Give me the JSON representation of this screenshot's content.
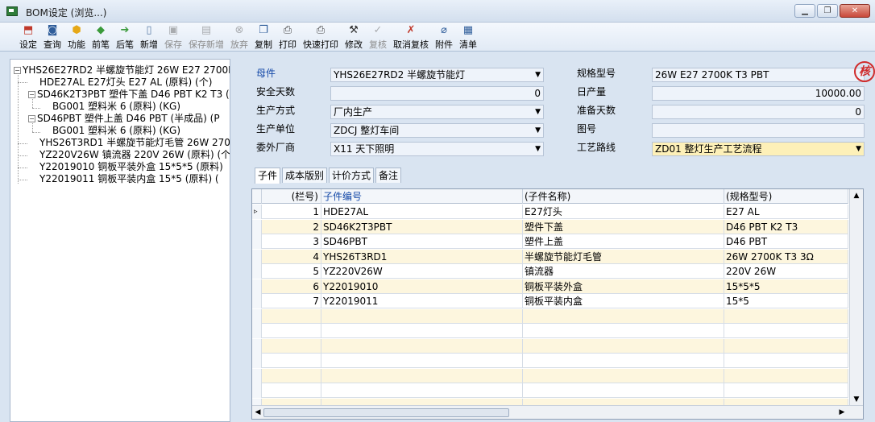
{
  "window": {
    "title": "BOM设定 (浏览...)",
    "controls": [
      "minimize",
      "maximize",
      "close"
    ]
  },
  "toolbar": [
    {
      "label": "设定",
      "icon": "settings-icon",
      "enabled": true
    },
    {
      "label": "查询",
      "icon": "query-icon",
      "enabled": true
    },
    {
      "label": "功能",
      "icon": "function-icon",
      "enabled": true
    },
    {
      "label": "前笔",
      "icon": "prev-icon",
      "enabled": true
    },
    {
      "label": "后笔",
      "icon": "next-icon",
      "enabled": true
    },
    {
      "label": "新增",
      "icon": "new-icon",
      "enabled": true
    },
    {
      "label": "保存",
      "icon": "save-icon",
      "enabled": false
    },
    {
      "label": "保存新增",
      "icon": "save-new-icon",
      "enabled": false
    },
    {
      "label": "放弃",
      "icon": "discard-icon",
      "enabled": false
    },
    {
      "label": "复制",
      "icon": "copy-icon",
      "enabled": true
    },
    {
      "label": "打印",
      "icon": "print-icon",
      "enabled": true
    },
    {
      "label": "快速打印",
      "icon": "quick-print-icon",
      "enabled": true
    },
    {
      "label": "修改",
      "icon": "edit-icon",
      "enabled": true
    },
    {
      "label": "复核",
      "icon": "review-icon",
      "enabled": false
    },
    {
      "label": "取消复核",
      "icon": "cancel-review-icon",
      "enabled": true
    },
    {
      "label": "附件",
      "icon": "attachment-icon",
      "enabled": true
    },
    {
      "label": "清单",
      "icon": "list-icon",
      "enabled": true
    }
  ],
  "tree": {
    "items": [
      {
        "text": "YHS26E27RD2 半螺旋节能灯 26W E27 2700K",
        "expander": "−"
      },
      {
        "text": "HDE27AL E27灯头 E27 AL (原料) (个)",
        "expander": ""
      },
      {
        "text": "SD46K2T3PBT 塑件下盖 D46 PBT K2 T3 (",
        "expander": "−"
      },
      {
        "text": "BG001 塑料米 6 (原料) (KG)",
        "expander": ""
      },
      {
        "text": "SD46PBT 塑件上盖 D46 PBT (半成品) (P",
        "expander": "−"
      },
      {
        "text": "BG001 塑料米 6 (原料) (KG)",
        "expander": ""
      },
      {
        "text": "YHS26T3RD1 半螺旋节能灯毛管 26W 2700",
        "expander": ""
      },
      {
        "text": "YZ220V26W 镇流器 220V 26W (原料) (个",
        "expander": ""
      },
      {
        "text": "Y22019010 铜板平装外盒 15*5*5 (原料)",
        "expander": ""
      },
      {
        "text": "Y22019011 铜板平装内盒 15*5 (原料) (",
        "expander": ""
      }
    ]
  },
  "form": {
    "parent_label": "母件",
    "parent_value": "YHS26E27RD2 半螺旋节能灯",
    "spec_label": "规格型号",
    "spec_value": "26W E27 2700K T3 PBT",
    "safety_days_label": "安全天数",
    "safety_days_value": "0",
    "daily_output_label": "日产量",
    "daily_output_value": "10000.00",
    "prod_method_label": "生产方式",
    "prod_method_value": "厂内生产",
    "prep_days_label": "准备天数",
    "prep_days_value": "0",
    "prod_unit_label": "生产单位",
    "prod_unit_value": "ZDCJ 整灯车间",
    "drawing_label": "图号",
    "drawing_value": "",
    "outsource_label": "委外厂商",
    "outsource_value": "X11 天下照明",
    "route_label": "工艺路线",
    "route_value": "ZD01 整灯生产工艺流程",
    "stamp_text": "核"
  },
  "tabs": [
    "子件",
    "成本版别",
    "计价方式",
    "备注"
  ],
  "grid": {
    "columns": [
      "(栏号)",
      "子件编号",
      "(子件名称)",
      "(规格型号)"
    ],
    "rows": [
      {
        "no": "1",
        "code": "HDE27AL",
        "name": "E27灯头",
        "spec": "E27 AL"
      },
      {
        "no": "2",
        "code": "SD46K2T3PBT",
        "name": "塑件下盖",
        "spec": "D46 PBT K2 T3"
      },
      {
        "no": "3",
        "code": "SD46PBT",
        "name": "塑件上盖",
        "spec": "D46 PBT"
      },
      {
        "no": "4",
        "code": "YHS26T3RD1",
        "name": "半螺旋节能灯毛管",
        "spec": "26W 2700K T3 3Ω"
      },
      {
        "no": "5",
        "code": "YZ220V26W",
        "name": "镇流器",
        "spec": "220V 26W"
      },
      {
        "no": "6",
        "code": "Y22019010",
        "name": "铜板平装外盒",
        "spec": "15*5*5"
      },
      {
        "no": "7",
        "code": "Y22019011",
        "name": "铜板平装内盒",
        "spec": "15*5"
      }
    ],
    "current_row_marker": "▹"
  },
  "colors": {
    "accent_blue": "#1549a8",
    "row_alt_yellow": "#fdf6de",
    "input_bg": "#eef3fa",
    "stamp_red": "#d02b2b"
  }
}
